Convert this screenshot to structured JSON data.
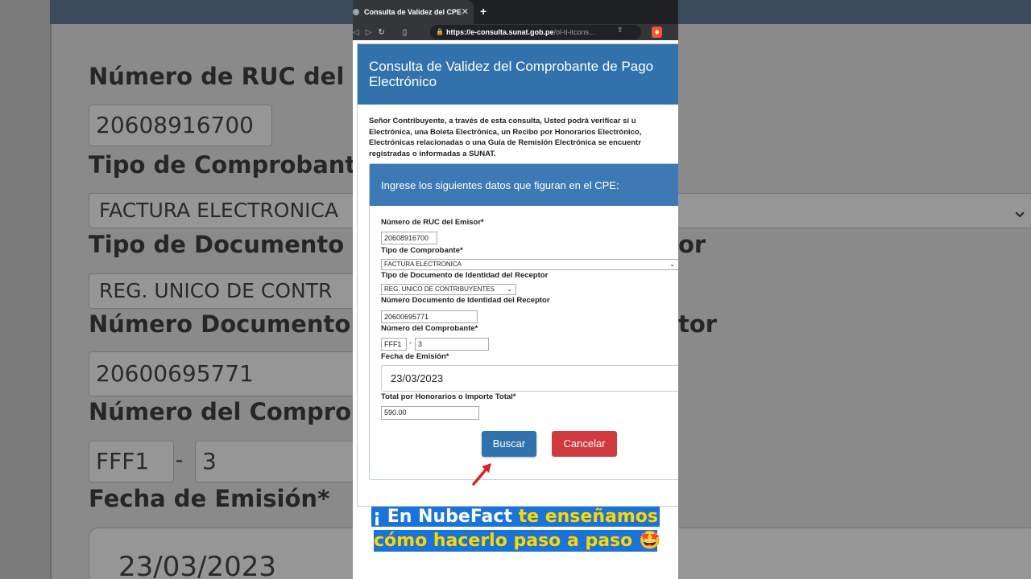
{
  "browser": {
    "tab_title": "Consulta de Validez del CPE",
    "url_host": "https://e-consulta.sunat.gob.pe",
    "url_path": "/ol-ti-itcons..."
  },
  "modal": {
    "title": "Consulta de Validez del Comprobante de Pago Electrónico",
    "intro_lines": [
      "Señor Contribuyente, a través de esta consulta, Usted podrá verificar si u",
      "Electrónica, una Boleta Electrónica, un Recibo por Honorarios Electrónico,",
      "Electrónicas relacionadas o una Guía de Remisión Electrónica se encuentr",
      "registradas o informadas a SUNAT."
    ],
    "panel_title": "Ingrese los siguientes datos que figuran en el CPE:",
    "fields": {
      "ruc_label": "Número de RUC del Emisor*",
      "ruc_value": "20608916700",
      "tipo_comprobante_label": "Tipo de Comprobante*",
      "tipo_comprobante_value": "FACTURA ELECTRONICA",
      "tipo_doc_label": "Tipo de Documento de Identidad del Receptor",
      "tipo_doc_value": "REG. UNICO DE CONTRIBUYENTES",
      "num_doc_label": "Número Documento de Identidad del Receptor",
      "num_doc_value": "20600695771",
      "num_comprobante_label": "Número del Comprobante*",
      "serie_value": "FFF1",
      "separator": "-",
      "numero_value": "3",
      "fecha_label": "Fecha de Emisión*",
      "fecha_value": "23/03/2023",
      "total_label": "Total por Honorarios o Importe Total*",
      "total_value": "590.00"
    },
    "buscar_label": "Buscar",
    "cancelar_label": "Cancelar"
  },
  "caption": {
    "line1_a": "¡ En NubeFact ",
    "line1_b": "te enseñamos",
    "line2": "cómo hacerlo paso a paso",
    "line2_end": " !"
  },
  "background": {
    "label_ruc": "Número de RUC del",
    "ruc": "20608916700",
    "label_tipo_comp": "Tipo de Comprobant",
    "tipo_comp": "FACTURA ELECTRONICA",
    "label_tipo_doc": "Tipo de Documento",
    "tipo_doc": "REG. UNICO DE CONTR",
    "label_num_doc": "Número Documento",
    "num_doc": "20600695771",
    "label_num_comp": "Número del Compro",
    "serie": "FFF1",
    "dash": "-",
    "numero": "3",
    "label_fecha": "Fecha de Emisión*",
    "fecha": "23/03/2023",
    "right_tail_1": "or",
    "right_tail_2": "tor"
  },
  "colors": {
    "header_blue": "#3272ac",
    "cancel_red": "#d0393e",
    "caption_blue": "#1a73d9",
    "caption_yellow": "#ffd700"
  }
}
